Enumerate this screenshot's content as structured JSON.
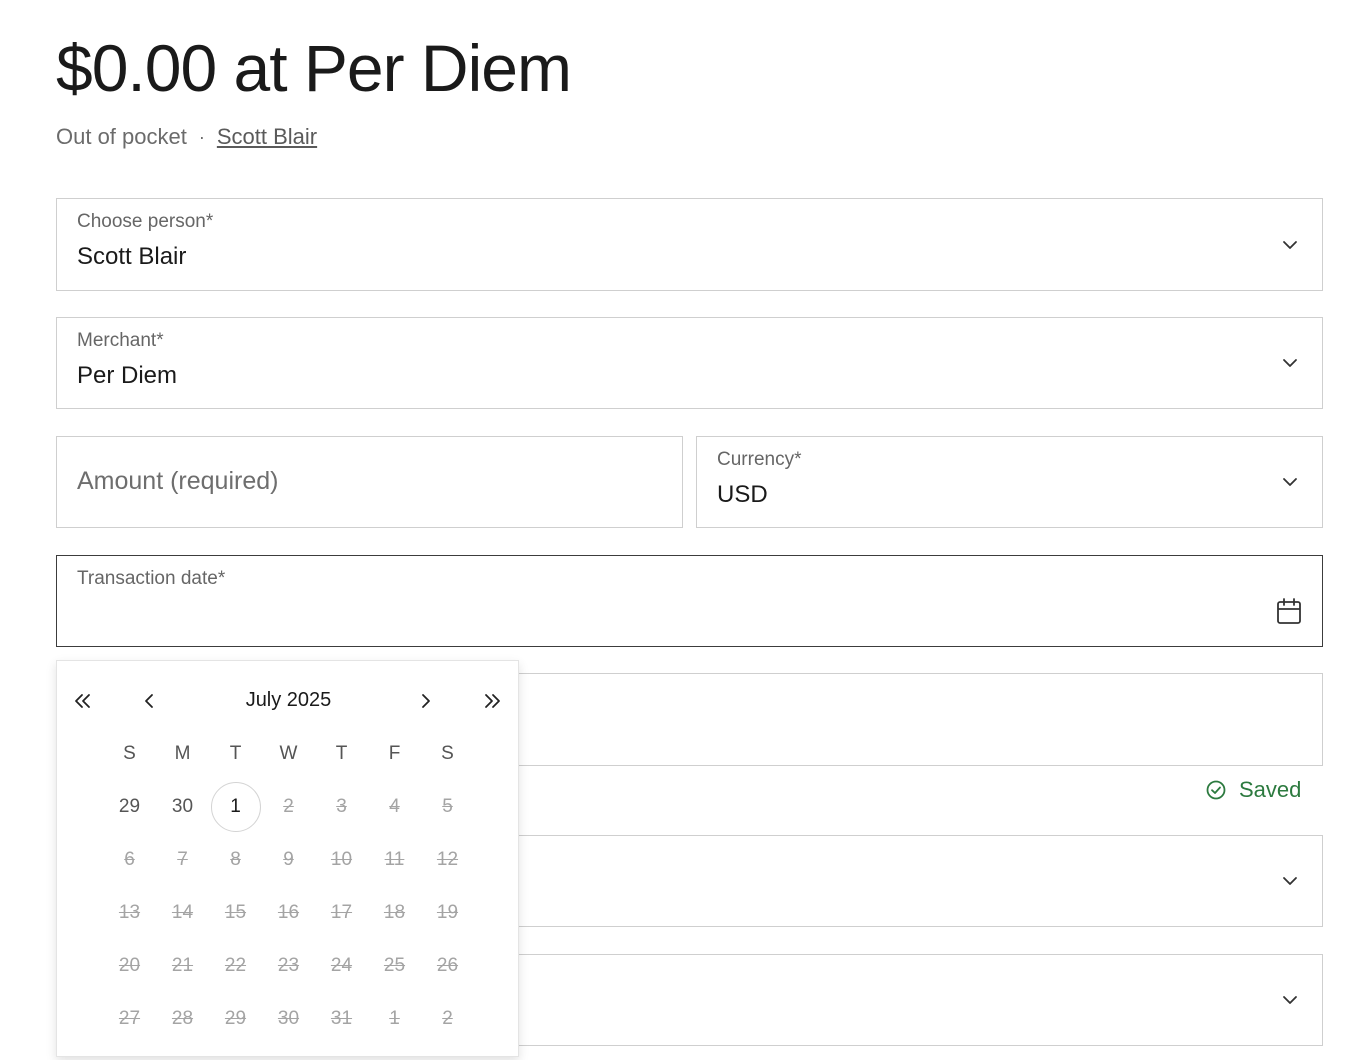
{
  "header": {
    "title": "$0.00 at Per Diem",
    "payment_type": "Out of pocket",
    "separator": "·",
    "person_link": "Scott Blair"
  },
  "form": {
    "person": {
      "label": "Choose person*",
      "value": "Scott Blair"
    },
    "merchant": {
      "label": "Merchant*",
      "value": "Per Diem"
    },
    "amount": {
      "placeholder": "Amount (required)",
      "value": ""
    },
    "currency": {
      "label": "Currency*",
      "value": "USD"
    },
    "transaction_date": {
      "label": "Transaction date*",
      "value": ""
    },
    "saved_status": "Saved"
  },
  "datepicker": {
    "month_label": "July 2025",
    "weekdays": [
      "S",
      "M",
      "T",
      "W",
      "T",
      "F",
      "S"
    ],
    "weeks": [
      [
        {
          "d": "29",
          "s": "enabled"
        },
        {
          "d": "30",
          "s": "enabled"
        },
        {
          "d": "1",
          "s": "today"
        },
        {
          "d": "2",
          "s": "disabled"
        },
        {
          "d": "3",
          "s": "disabled"
        },
        {
          "d": "4",
          "s": "disabled"
        },
        {
          "d": "5",
          "s": "disabled"
        }
      ],
      [
        {
          "d": "6",
          "s": "disabled"
        },
        {
          "d": "7",
          "s": "disabled"
        },
        {
          "d": "8",
          "s": "disabled"
        },
        {
          "d": "9",
          "s": "disabled"
        },
        {
          "d": "10",
          "s": "disabled"
        },
        {
          "d": "11",
          "s": "disabled"
        },
        {
          "d": "12",
          "s": "disabled"
        }
      ],
      [
        {
          "d": "13",
          "s": "disabled"
        },
        {
          "d": "14",
          "s": "disabled"
        },
        {
          "d": "15",
          "s": "disabled"
        },
        {
          "d": "16",
          "s": "disabled"
        },
        {
          "d": "17",
          "s": "disabled"
        },
        {
          "d": "18",
          "s": "disabled"
        },
        {
          "d": "19",
          "s": "disabled"
        }
      ],
      [
        {
          "d": "20",
          "s": "disabled"
        },
        {
          "d": "21",
          "s": "disabled"
        },
        {
          "d": "22",
          "s": "disabled"
        },
        {
          "d": "23",
          "s": "disabled"
        },
        {
          "d": "24",
          "s": "disabled"
        },
        {
          "d": "25",
          "s": "disabled"
        },
        {
          "d": "26",
          "s": "disabled"
        }
      ],
      [
        {
          "d": "27",
          "s": "disabled"
        },
        {
          "d": "28",
          "s": "disabled"
        },
        {
          "d": "29",
          "s": "disabled"
        },
        {
          "d": "30",
          "s": "disabled"
        },
        {
          "d": "31",
          "s": "disabled"
        },
        {
          "d": "1",
          "s": "disabled"
        },
        {
          "d": "2",
          "s": "disabled"
        }
      ]
    ]
  },
  "colors": {
    "saved_green": "#2c7a3f",
    "focused_border": "#3c3c3c",
    "field_border": "#cfcfcf"
  },
  "icons": {
    "dropdown": "chevron-down-icon",
    "calendar": "calendar-icon",
    "saved": "check-circle-icon",
    "nav": [
      "double-chevron-left-icon",
      "chevron-left-icon",
      "chevron-right-icon",
      "double-chevron-right-icon"
    ]
  }
}
